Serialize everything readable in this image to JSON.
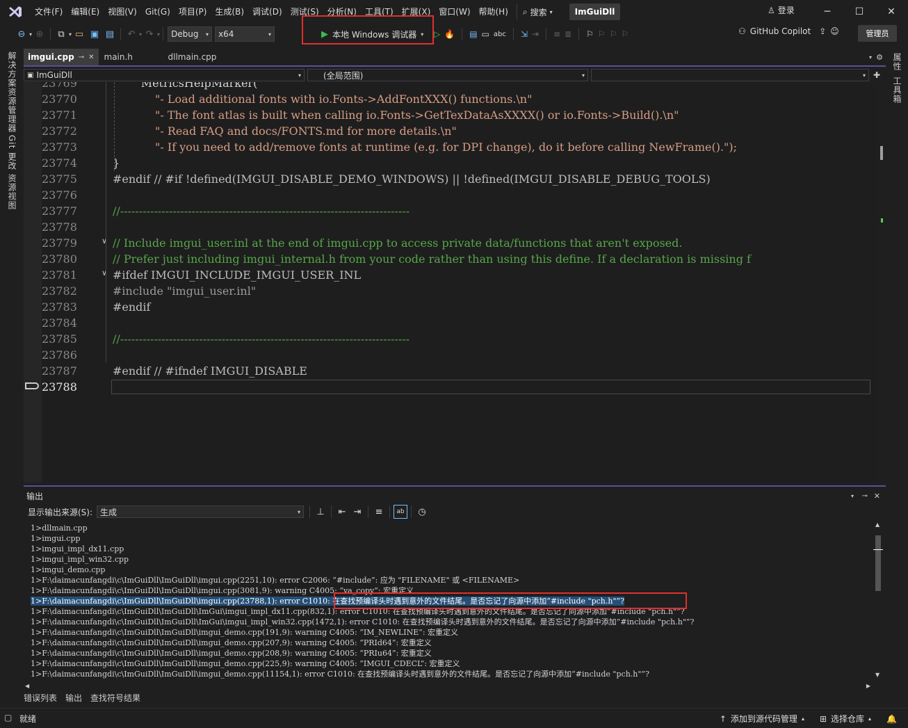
{
  "menu": {
    "items": [
      "文件(F)",
      "编辑(E)",
      "视图(V)",
      "Git(G)",
      "项目(P)",
      "生成(B)",
      "调试(D)",
      "测试(S)",
      "分析(N)",
      "工具(T)",
      "扩展(X)",
      "窗口(W)",
      "帮助(H)"
    ],
    "search_label": "搜索",
    "solution_name": "ImGuiDll",
    "login_label": "登录"
  },
  "toolbar": {
    "config": "Debug",
    "platform": "x64",
    "run_label": "本地 Windows 调试器",
    "copilot_label": "GitHub Copilot",
    "admin_label": "管理员"
  },
  "side_tabs": {
    "left": [
      "解决方案资源管理器",
      "Git 更改",
      "资源视图"
    ],
    "right": [
      "属性",
      "工具箱"
    ]
  },
  "doc_tabs": [
    {
      "label": "imgui.cpp",
      "active": true
    },
    {
      "label": "main.h",
      "active": false
    },
    {
      "label": "dllmain.cpp",
      "active": false
    }
  ],
  "nav": {
    "project": "ImGuiDll",
    "scope": "(全局范围)"
  },
  "editor": {
    "lines": [
      {
        "num": "23769",
        "text": "        MetricsHelpMarker("
      },
      {
        "num": "23770",
        "text": "            \"- Load additional fonts with io.Fonts->AddFontXXX() functions.\\n\""
      },
      {
        "num": "23771",
        "text": "            \"- The font atlas is built when calling io.Fonts->GetTexDataAsXXXX() or io.Fonts->Build().\\n\""
      },
      {
        "num": "23772",
        "text": "            \"- Read FAQ and docs/FONTS.md for more details.\\n\""
      },
      {
        "num": "23773",
        "text": "            \"- If you need to add/remove fonts at runtime (e.g. for DPI change), do it before calling NewFrame().\");"
      },
      {
        "num": "23774",
        "text": "}"
      },
      {
        "num": "23775",
        "text": "#endif // #if !defined(IMGUI_DISABLE_DEMO_WINDOWS) || !defined(IMGUI_DISABLE_DEBUG_TOOLS)"
      },
      {
        "num": "23776",
        "text": ""
      },
      {
        "num": "23777",
        "text": "//-----------------------------------------------------------------------------"
      },
      {
        "num": "23778",
        "text": ""
      },
      {
        "num": "23779",
        "text": "// Include imgui_user.inl at the end of imgui.cpp to access private data/functions that aren't exposed."
      },
      {
        "num": "23780",
        "text": "// Prefer just including imgui_internal.h from your code rather than using this define. If a declaration is missing f"
      },
      {
        "num": "23781",
        "text": "#ifdef IMGUI_INCLUDE_IMGUI_USER_INL"
      },
      {
        "num": "23782",
        "text": "#include \"imgui_user.inl\""
      },
      {
        "num": "23783",
        "text": "#endif"
      },
      {
        "num": "23784",
        "text": ""
      },
      {
        "num": "23785",
        "text": "//-----------------------------------------------------------------------------"
      },
      {
        "num": "23786",
        "text": ""
      },
      {
        "num": "23787",
        "text": "#endif // #ifndef IMGUI_DISABLE"
      },
      {
        "num": "23788",
        "text": ""
      }
    ],
    "current_line": "23788"
  },
  "output": {
    "title": "输出",
    "source_label": "显示输出来源(S):",
    "source_value": "生成",
    "lines": [
      "1>dllmain.cpp",
      "1>imgui.cpp",
      "1>imgui_impl_dx11.cpp",
      "1>imgui_impl_win32.cpp",
      "1>imgui_demo.cpp",
      "1>F:\\daimacunfangdi\\c\\ImGuiDll\\ImGuiDll\\imgui.cpp(2251,10): error C2006: “#include”: 应为 \"FILENAME\" 或 <FILENAME>",
      "1>F:\\daimacunfangdi\\c\\ImGuiDll\\ImGuiDll\\imgui.cpp(3081,9): warning C4005: “va_copy”: 宏重定义",
      "1>F:\\daimacunfangdi\\c\\ImGuiDll\\ImGuiDll\\imgui.cpp(23788,1): error C1010: 在查找预编译头时遇到意外的文件结尾。是否忘记了向源中添加“#include \"pch.h\"”?",
      "1>F:\\daimacunfangdi\\c\\ImGuiDll\\ImGuiDll\\ImGui\\imgui_impl_dx11.cpp(832,1): error C1010: 在查找预编译头时遇到意外的文件结尾。是否忘记了向源中添加“#include \"pch.h\"”?",
      "1>F:\\daimacunfangdi\\c\\ImGuiDll\\ImGuiDll\\ImGui\\imgui_impl_win32.cpp(1472,1): error C1010: 在查找预编译头时遇到意外的文件结尾。是否忘记了向源中添加“#include \"pch.h\"”?",
      "1>F:\\daimacunfangdi\\c\\ImGuiDll\\ImGuiDll\\imgui_demo.cpp(191,9): warning C4005: “IM_NEWLINE”: 宏重定义",
      "1>F:\\daimacunfangdi\\c\\ImGuiDll\\ImGuiDll\\imgui_demo.cpp(207,9): warning C4005: “PRId64”: 宏重定义",
      "1>F:\\daimacunfangdi\\c\\ImGuiDll\\ImGuiDll\\imgui_demo.cpp(208,9): warning C4005: “PRIu64”: 宏重定义",
      "1>F:\\daimacunfangdi\\c\\ImGuiDll\\ImGuiDll\\imgui_demo.cpp(225,9): warning C4005: “IMGUI_CDECL”: 宏重定义",
      "1>F:\\daimacunfangdi\\c\\ImGuiDll\\ImGuiDll\\imgui_demo.cpp(11154,1): error C1010: 在查找预编译头时遇到意外的文件结尾。是否忘记了向源中添加“#include \"pch.h\"”?"
    ],
    "selected_index": 7
  },
  "bottom_tabs": [
    "错误列表",
    "输出",
    "查找符号结果"
  ],
  "status": {
    "ready": "就绪",
    "add_source_control": "添加到源代码管理",
    "select_repo": "选择仓库"
  },
  "colors": {
    "accent": "#5b4e9c",
    "highlight_box": "#e0302f",
    "run_green": "#3fb950",
    "selection": "#264f78"
  }
}
